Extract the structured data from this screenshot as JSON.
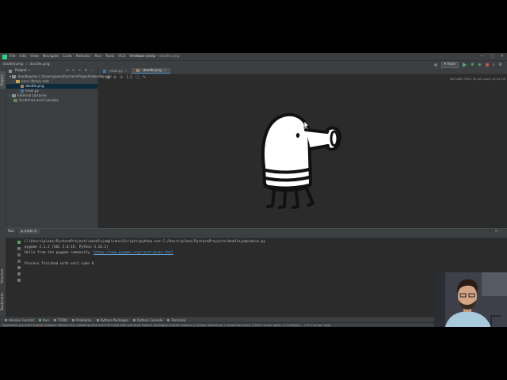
{
  "menu": {
    "items": [
      "File",
      "Edit",
      "View",
      "Navigate",
      "Code",
      "Refactor",
      "Run",
      "Tools",
      "VCS",
      "Window",
      "Help"
    ],
    "window_title": "doodlejump - doodle.png"
  },
  "navbar": {
    "crumb1": "doodlejump",
    "crumb2": "doodle.png",
    "run_config": "main"
  },
  "project_panel": {
    "title": "Project",
    "tree": [
      {
        "label": "doodlejump  C:\\Users\\pleas\\PycharmProjects\\doodlejump",
        "kind": "folder",
        "indent": 0,
        "selected": false
      },
      {
        "label": "venv  library root",
        "kind": "folder",
        "indent": 1,
        "selected": false
      },
      {
        "label": "doodle.png",
        "kind": "png",
        "indent": 2,
        "selected": true
      },
      {
        "label": "main.py",
        "kind": "py",
        "indent": 2,
        "selected": false
      },
      {
        "label": "External Libraries",
        "kind": "folder",
        "indent": 0,
        "selected": false
      },
      {
        "label": "Scratches and Consoles",
        "kind": "folder",
        "indent": 0,
        "selected": false
      }
    ]
  },
  "editor_tabs": [
    {
      "label": "main.py",
      "active": false
    },
    {
      "label": "doodle.png",
      "active": true
    }
  ],
  "image_info": "887x880 PNG (32-bit color) 41.51 kB",
  "run_panel": {
    "title": "Run",
    "tab": "main",
    "lines": [
      {
        "text": "C:\\Users\\pleas\\PycharmProjects\\doodlejump\\venv\\Scripts\\python.exe C:/Users/pleas/PycharmProjects/doodlejump/main.py"
      },
      {
        "text": "pygame 2.1.2 (SDL 2.0.18, Python 3.10.2)"
      },
      {
        "text": "Hello from the pygame community. ",
        "link": "https://www.pygame.org/contribute.html"
      },
      {
        "text": ""
      },
      {
        "text": "Process finished with exit code 0"
      }
    ]
  },
  "tool_windows": [
    "Version Control",
    "Run",
    "TODO",
    "Problems",
    "Python Packages",
    "Python Console",
    "Terminal"
  ],
  "left_tool_tabs": [
    "Project",
    "Structure",
    "Bookmarks"
  ],
  "status_message": "Download pre-built shared indexes: Reduce the indexing time and CPU load with pre-built Python packages shared indexes // Always download // Download once // Don't show again // Configure... (23 minutes ago)",
  "colors": {
    "ide_bg": "#2b2b2b",
    "panel_bg": "#3c3f41",
    "accent": "#4a88c7",
    "link": "#5f9fd0",
    "run_green": "#59a869"
  }
}
